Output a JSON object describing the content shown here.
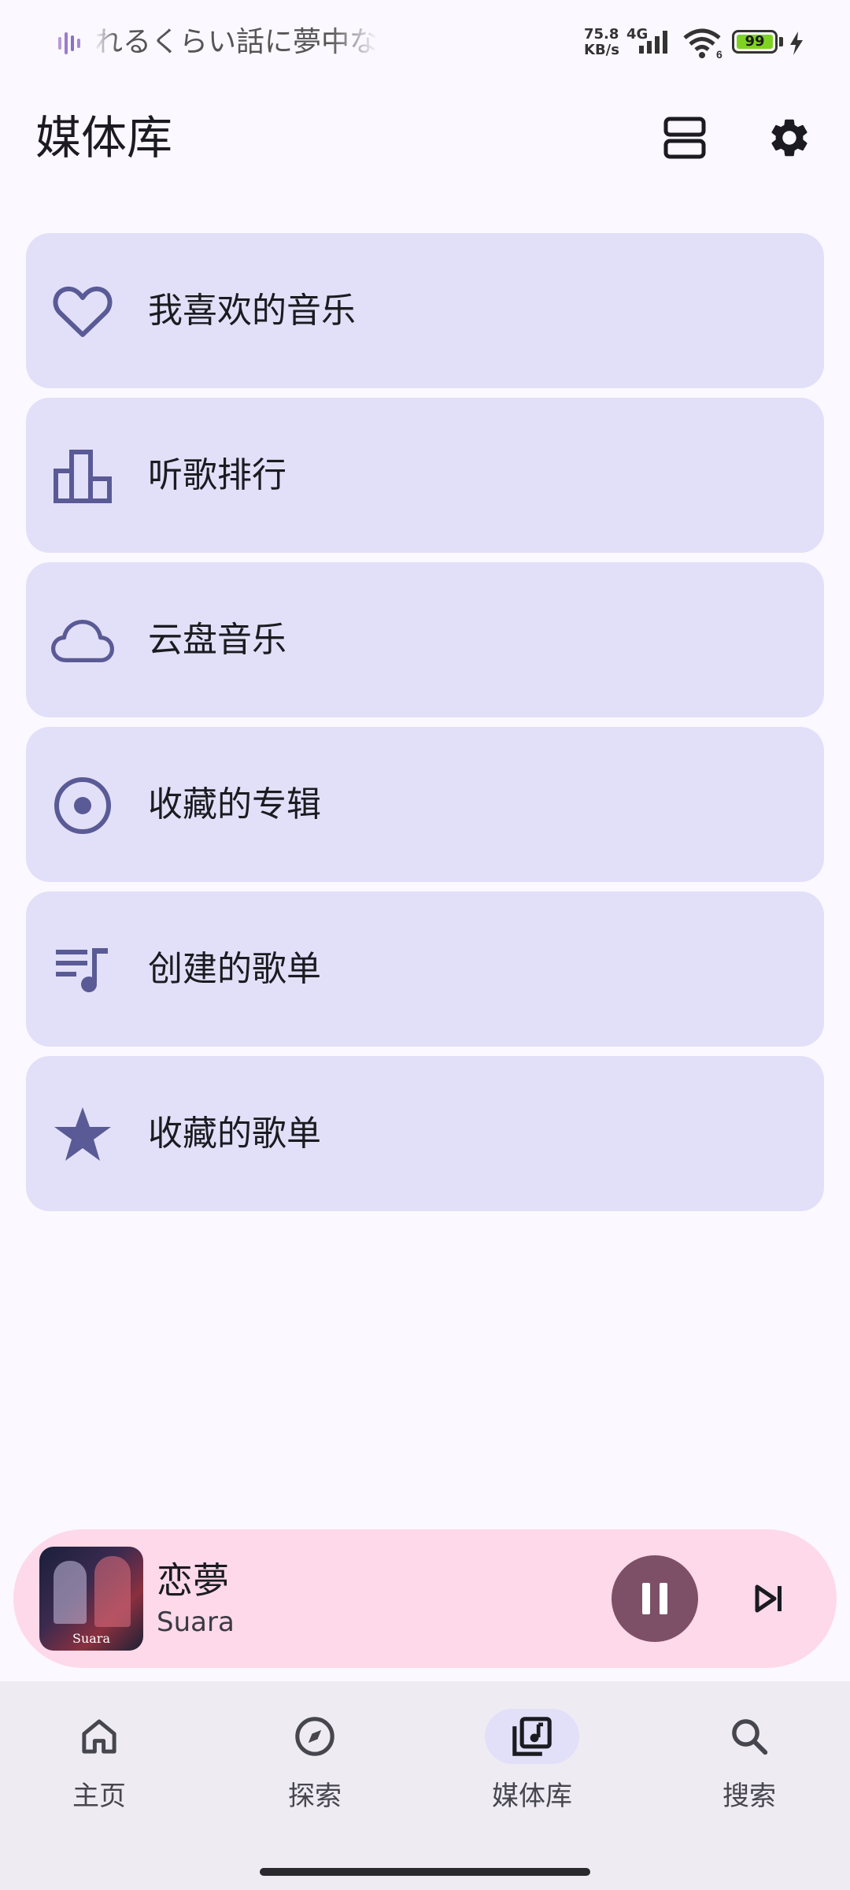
{
  "status_bar": {
    "now_playing_marquee": "れるくらい話に夢中な",
    "net_speed": "75.8\nKB/s",
    "network_type": "4G",
    "battery_level": "99",
    "wifi_badge": "6"
  },
  "header": {
    "title": "媒体库",
    "view_toggle_icon": "view-agenda-icon",
    "settings_icon": "gear-icon"
  },
  "library": {
    "items": [
      {
        "label": "我喜欢的音乐",
        "icon": "heart-icon"
      },
      {
        "label": "听歌排行",
        "icon": "leaderboard-icon"
      },
      {
        "label": "云盘音乐",
        "icon": "cloud-icon"
      },
      {
        "label": "收藏的专辑",
        "icon": "album-icon"
      },
      {
        "label": "创建的歌单",
        "icon": "playlist-icon"
      },
      {
        "label": "收藏的歌单",
        "icon": "star-icon"
      }
    ]
  },
  "player": {
    "title": "恋夢",
    "artist": "Suara",
    "album_caption": "Suara",
    "state": "playing"
  },
  "nav": {
    "items": [
      {
        "label": "主页",
        "icon": "home-icon",
        "active": false
      },
      {
        "label": "探索",
        "icon": "compass-icon",
        "active": false
      },
      {
        "label": "媒体库",
        "icon": "library-music-icon",
        "active": true
      },
      {
        "label": "搜索",
        "icon": "search-icon",
        "active": false
      }
    ]
  },
  "colors": {
    "background": "#fbf8ff",
    "card": "#e2e0f8",
    "icon_accent": "#5a5a96",
    "player_bg": "#fdd9e9",
    "pause_button": "#7d5068",
    "nav_bg": "#efebf3"
  }
}
